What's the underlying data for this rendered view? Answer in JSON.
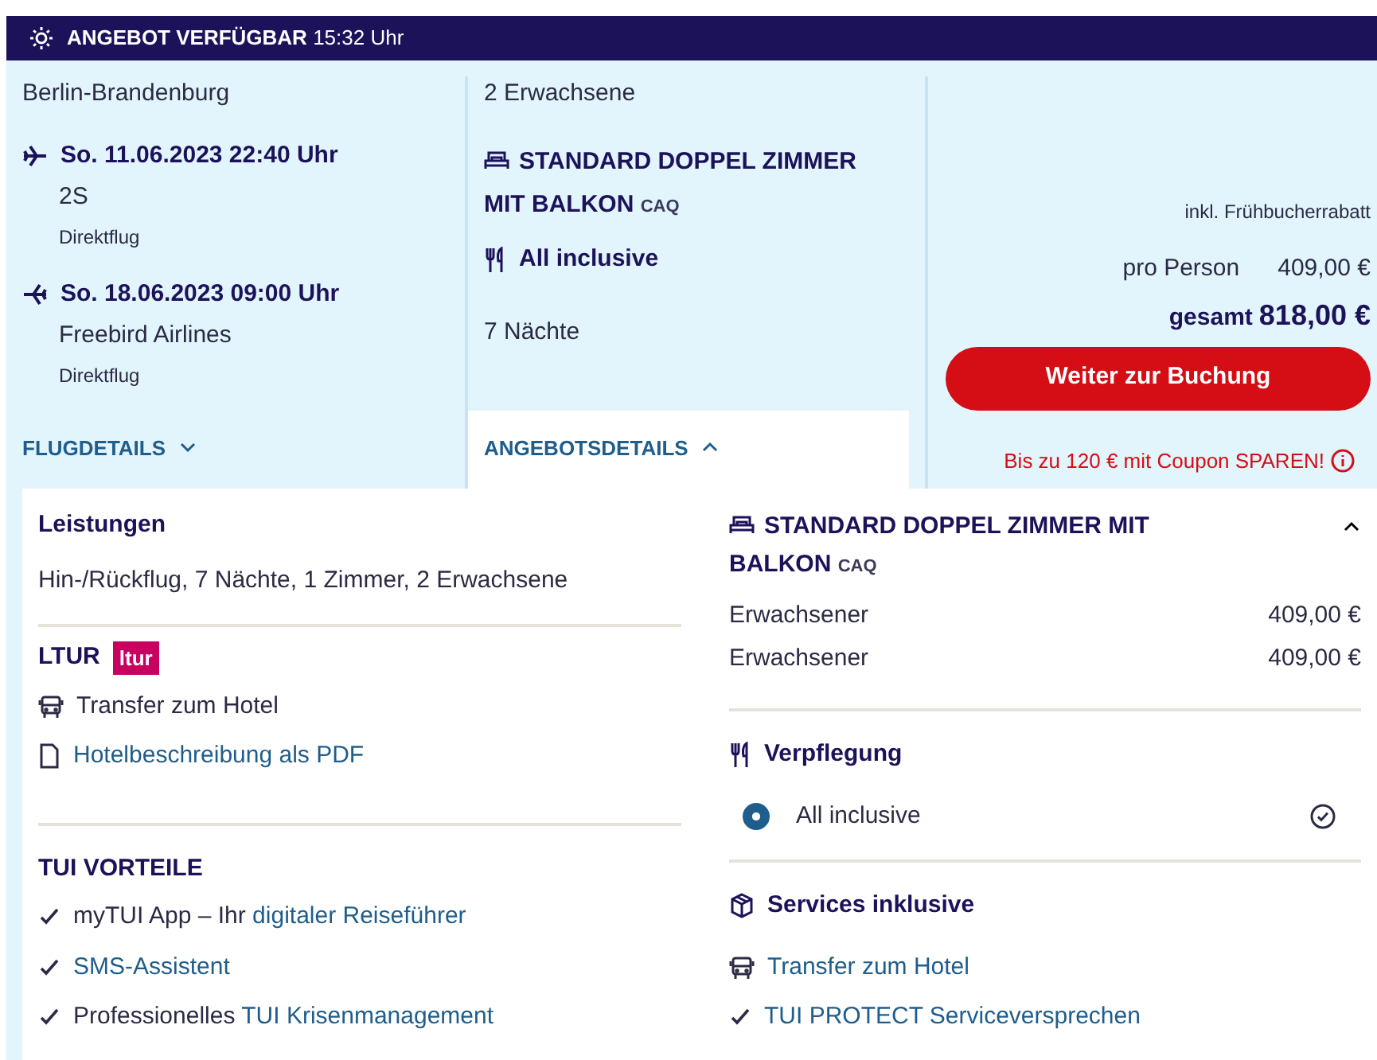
{
  "header": {
    "title": "ANGEBOT VERFÜGBAR",
    "time": "15:32 Uhr"
  },
  "summary": {
    "departure_airport": "Berlin-Brandenburg",
    "flights": [
      {
        "kind": "outbound",
        "date": "So. 11.06.2023 22:40 Uhr",
        "carrier": "2S",
        "type": "Direktflug"
      },
      {
        "kind": "return",
        "date": "So. 18.06.2023 09:00 Uhr",
        "carrier": "Freebird Airlines",
        "type": "Direktflug"
      }
    ],
    "travellers": "2 Erwachsene",
    "room": {
      "name": "STANDARD DOPPEL ZIMMER MIT BALKON",
      "code": "CAQ"
    },
    "board": "All inclusive",
    "nights": "7 Nächte",
    "toggles": [
      {
        "label": "FLUGDETAILS",
        "expanded": false
      },
      {
        "label": "ANGEBOTSDETAILS",
        "expanded": true
      }
    ],
    "price": {
      "discount_note": "inkl. Frühbucherrabatt",
      "per_person_label": "pro Person",
      "per_person": "409,00 €",
      "total_label": "gesamt",
      "total": "818,00 €"
    },
    "book_button": "Weiter zur Buchung",
    "coupon_note": "Bis zu 120 € mit Coupon SPAREN!"
  },
  "details": {
    "services": {
      "title": "Leistungen",
      "text": "Hin-/Rückflug, 7 Nächte, 1 Zimmer, 2 Erwachsene"
    },
    "operator": {
      "title": "LTUR",
      "logo": "ltur",
      "items": [
        {
          "kind": "transfer",
          "text": "Transfer zum Hotel"
        },
        {
          "kind": "pdf",
          "text": "Hotelbeschreibung als PDF"
        }
      ]
    },
    "benefits": {
      "title": "TUI VORTEILE",
      "items": [
        {
          "prefix": "myTUI App – Ihr",
          "link": "digitaler Reiseführer"
        },
        {
          "link": "SMS-Assistent"
        },
        {
          "prefix": "Professionelles",
          "link": "TUI Krisenmanagement"
        }
      ]
    },
    "room": {
      "name": "STANDARD DOPPEL ZIMMER MIT BALKON",
      "code": "CAQ",
      "expanded": true,
      "lines": [
        {
          "label": "Erwachsener",
          "price": "409,00 €"
        },
        {
          "label": "Erwachsener",
          "price": "409,00 €"
        }
      ]
    },
    "meals": {
      "title": "Verpflegung",
      "options": [
        {
          "label": "All inclusive",
          "selected": true
        }
      ]
    },
    "included": {
      "title": "Services inklusive",
      "items": [
        {
          "kind": "transfer",
          "text": "Transfer zum Hotel"
        },
        {
          "kind": "check",
          "text": "TUI PROTECT Serviceversprechen"
        }
      ]
    }
  }
}
